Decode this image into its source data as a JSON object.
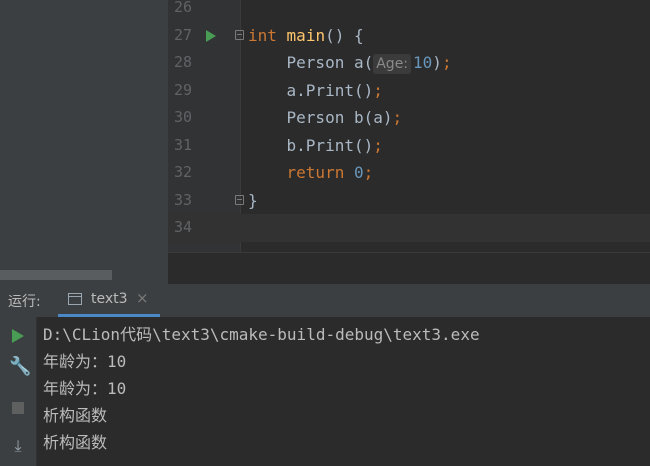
{
  "editor": {
    "lines": [
      {
        "no": "26"
      },
      {
        "no": "27",
        "int": "int",
        "main": "main",
        "rest": "() {"
      },
      {
        "no": "28",
        "pre": "    Person a(",
        "hint": "Age:",
        "num": "10",
        "post": ")",
        "semi": ";"
      },
      {
        "no": "29",
        "pre": "    a.Print()",
        "semi": ";"
      },
      {
        "no": "30",
        "pre": "    Person b(a)",
        "semi": ";"
      },
      {
        "no": "31",
        "pre": "    b.Print()",
        "semi": ";"
      },
      {
        "no": "32",
        "kw": "return",
        "num": "0",
        "semi": ";"
      },
      {
        "no": "33",
        "brace": "}"
      },
      {
        "no": "34"
      }
    ]
  },
  "run_panel": {
    "label": "运行:",
    "tab_label": "text3",
    "close": "×"
  },
  "console": {
    "lines": [
      "D:\\CLion代码\\text3\\cmake-build-debug\\text3.exe",
      "年龄为：10",
      "年龄为：10",
      "析构函数",
      "析构函数"
    ]
  },
  "icons": {
    "wrench": "🔧",
    "scroll_end": "⤓"
  },
  "colors": {
    "keyword": "#cc7832",
    "function": "#ffc66d",
    "number": "#6897bb",
    "run_green": "#499c54",
    "tab_underline": "#4a88c7"
  }
}
